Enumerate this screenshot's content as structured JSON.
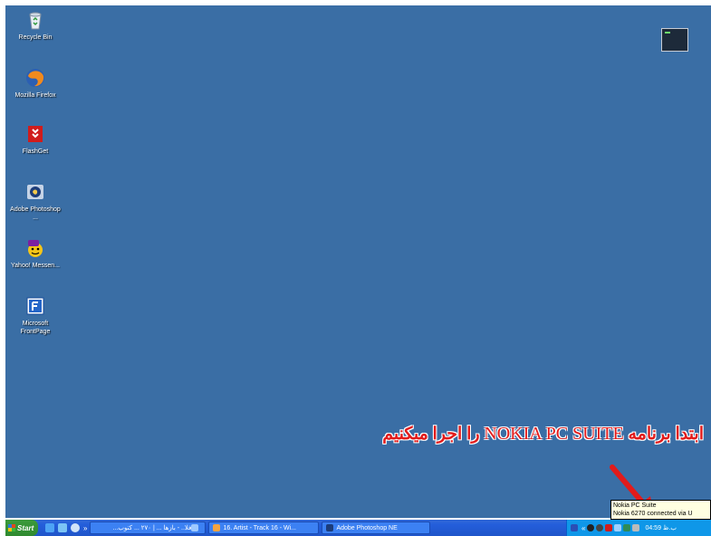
{
  "desktop": {
    "icons": [
      {
        "label": "Recycle Bin",
        "icon": "recycle-bin-icon"
      },
      {
        "label": "Mozilla Firefox",
        "icon": "firefox-icon"
      },
      {
        "label": "FlashGet",
        "icon": "flashget-icon"
      },
      {
        "label": "Adobe Photoshop ...",
        "icon": "photoshop-icon"
      },
      {
        "label": "Yahoo! Messen...",
        "icon": "yahoo-messenger-icon"
      },
      {
        "label": "Microsoft FrontPage",
        "icon": "frontpage-icon"
      }
    ],
    "background_color": "#3a6ea5"
  },
  "annotation": {
    "part1": "ابتدا برنامه ",
    "part2": "NOKIA PC SUITE",
    "part3": " را اجرا میکنیم",
    "color": "#e21b1b"
  },
  "tooltip": {
    "line1": "Nokia PC Suite",
    "line2": "Nokia 6270 connected via U"
  },
  "taskbar": {
    "start_label": "Start",
    "chevron": "»",
    "buttons": [
      {
        "label": "فلا.. - بازها ... | ۲۷۰ ... کتوب..."
      },
      {
        "label": "16. Artist - Track 16 - Wi..."
      },
      {
        "label": "Adobe Photoshop NE"
      }
    ],
    "tray_chevron": "«",
    "clock": "04:59 ب.ظ"
  }
}
